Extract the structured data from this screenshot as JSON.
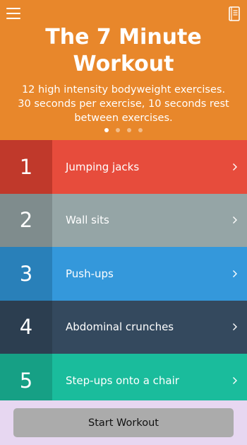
{
  "header": {
    "title": "The 7 Minute\nWorkout",
    "subtitle": "12 high intensity bodyweight exercises. 30 seconds per exercise, 10 seconds rest between exercises.",
    "background": "#E8872B",
    "page_count": 4,
    "active_page": 1
  },
  "exercises": [
    {
      "number": "1",
      "name": "Jumping jacks",
      "color": "#E74C3C",
      "num_color": "#C0392B"
    },
    {
      "number": "2",
      "name": "Wall sits",
      "color": "#95A5A6",
      "num_color": "#7F8C8D"
    },
    {
      "number": "3",
      "name": "Push-ups",
      "color": "#3498DB",
      "num_color": "#2980B9"
    },
    {
      "number": "4",
      "name": "Abdominal crunches",
      "color": "#34495E",
      "num_color": "#2C3E50"
    },
    {
      "number": "5",
      "name": "Step-ups onto a chair",
      "color": "#1ABC9C",
      "num_color": "#16A085"
    }
  ],
  "footer": {
    "start_label": "Start Workout",
    "background": "#E7D7F1",
    "button_color": "#ABABAB"
  },
  "icons": {
    "menu": "hamburger-menu-icon",
    "notebook": "notebook-icon",
    "chevron": "chevron-right-icon"
  }
}
